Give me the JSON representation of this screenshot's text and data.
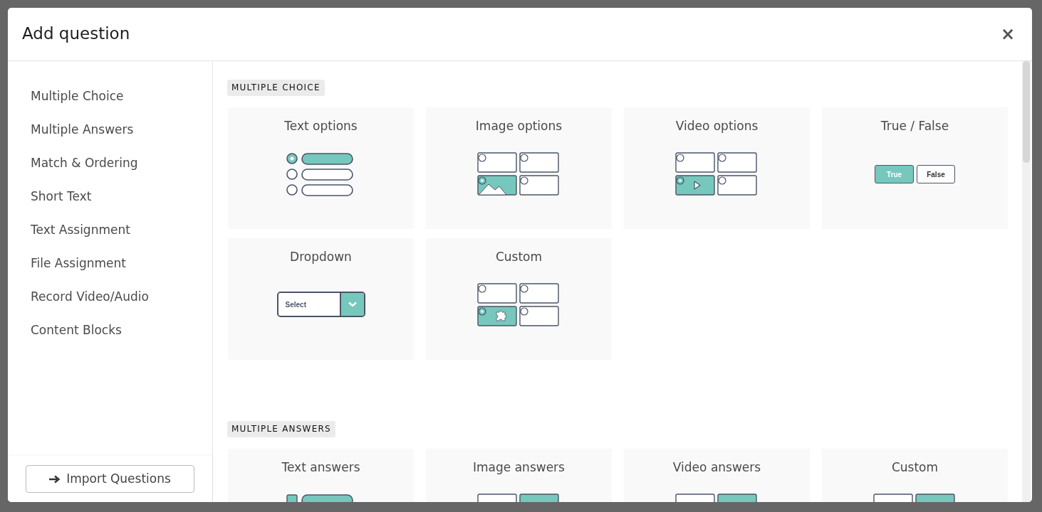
{
  "dialog": {
    "title": "Add question",
    "close": "×"
  },
  "sidebar": {
    "items": [
      {
        "label": "Multiple Choice",
        "selected": false
      },
      {
        "label": "Multiple Answers",
        "selected": false
      },
      {
        "label": "Match & Ordering",
        "selected": false
      },
      {
        "label": "Short Text",
        "selected": false
      },
      {
        "label": "Text Assignment",
        "selected": false
      },
      {
        "label": "File Assignment",
        "selected": false
      },
      {
        "label": "Record Video/Audio",
        "selected": false
      },
      {
        "label": "Content Blocks",
        "selected": false
      }
    ],
    "import_button": "Import Questions"
  },
  "sections": [
    {
      "heading": "MULTIPLE CHOICE",
      "cards": [
        {
          "title": "Text options",
          "kind": "text-list"
        },
        {
          "title": "Image options",
          "kind": "image-grid"
        },
        {
          "title": "Video options",
          "kind": "video-grid"
        },
        {
          "title": "True / False",
          "kind": "true-false",
          "true_label": "True",
          "false_label": "False"
        },
        {
          "title": "Dropdown",
          "kind": "dropdown",
          "select_label": "Select"
        },
        {
          "title": "Custom",
          "kind": "custom-grid"
        }
      ]
    },
    {
      "heading": "MULTIPLE ANSWERS",
      "cards": [
        {
          "title": "Text answers",
          "kind": "text-checks"
        },
        {
          "title": "Image answers",
          "kind": "answer-grid"
        },
        {
          "title": "Video answers",
          "kind": "answer-grid"
        },
        {
          "title": "Custom",
          "kind": "answer-grid"
        }
      ]
    }
  ]
}
